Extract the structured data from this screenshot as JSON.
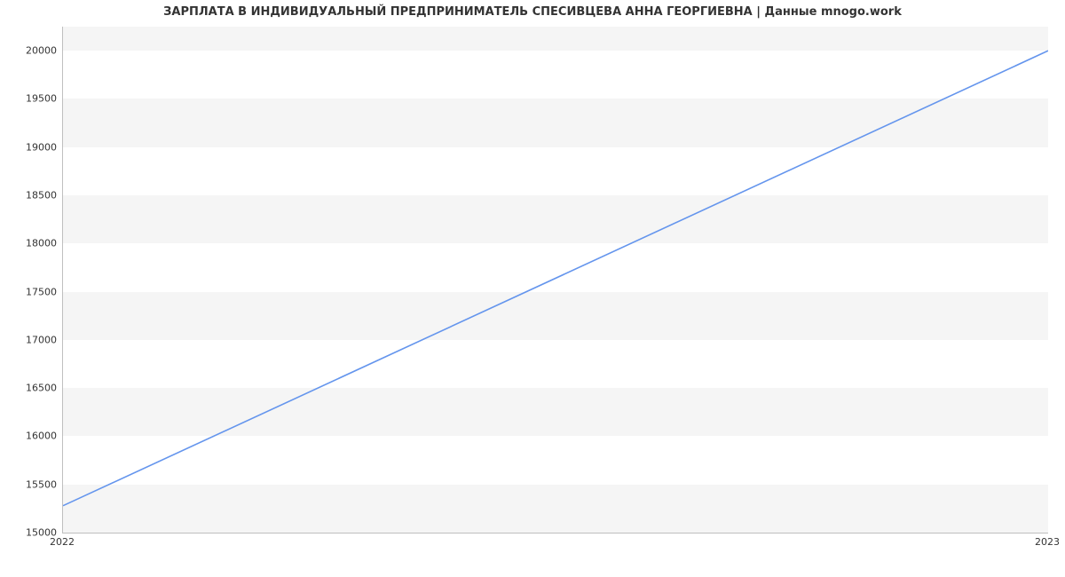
{
  "chart_data": {
    "type": "line",
    "title": "ЗАРПЛАТА В ИНДИВИДУАЛЬНЫЙ ПРЕДПРИНИМАТЕЛЬ СПЕСИВЦЕВА АННА ГЕОРГИЕВНА | Данные mnogo.work",
    "xlabel": "",
    "ylabel": "",
    "x": [
      "2022",
      "2023"
    ],
    "values": [
      15279,
      20000
    ],
    "x_ticks": [
      "2022",
      "2023"
    ],
    "y_ticks": [
      15000,
      15500,
      16000,
      16500,
      17000,
      17500,
      18000,
      18500,
      19000,
      19500,
      20000
    ],
    "ylim": [
      15000,
      20250
    ],
    "line_color": "#6495ed"
  }
}
